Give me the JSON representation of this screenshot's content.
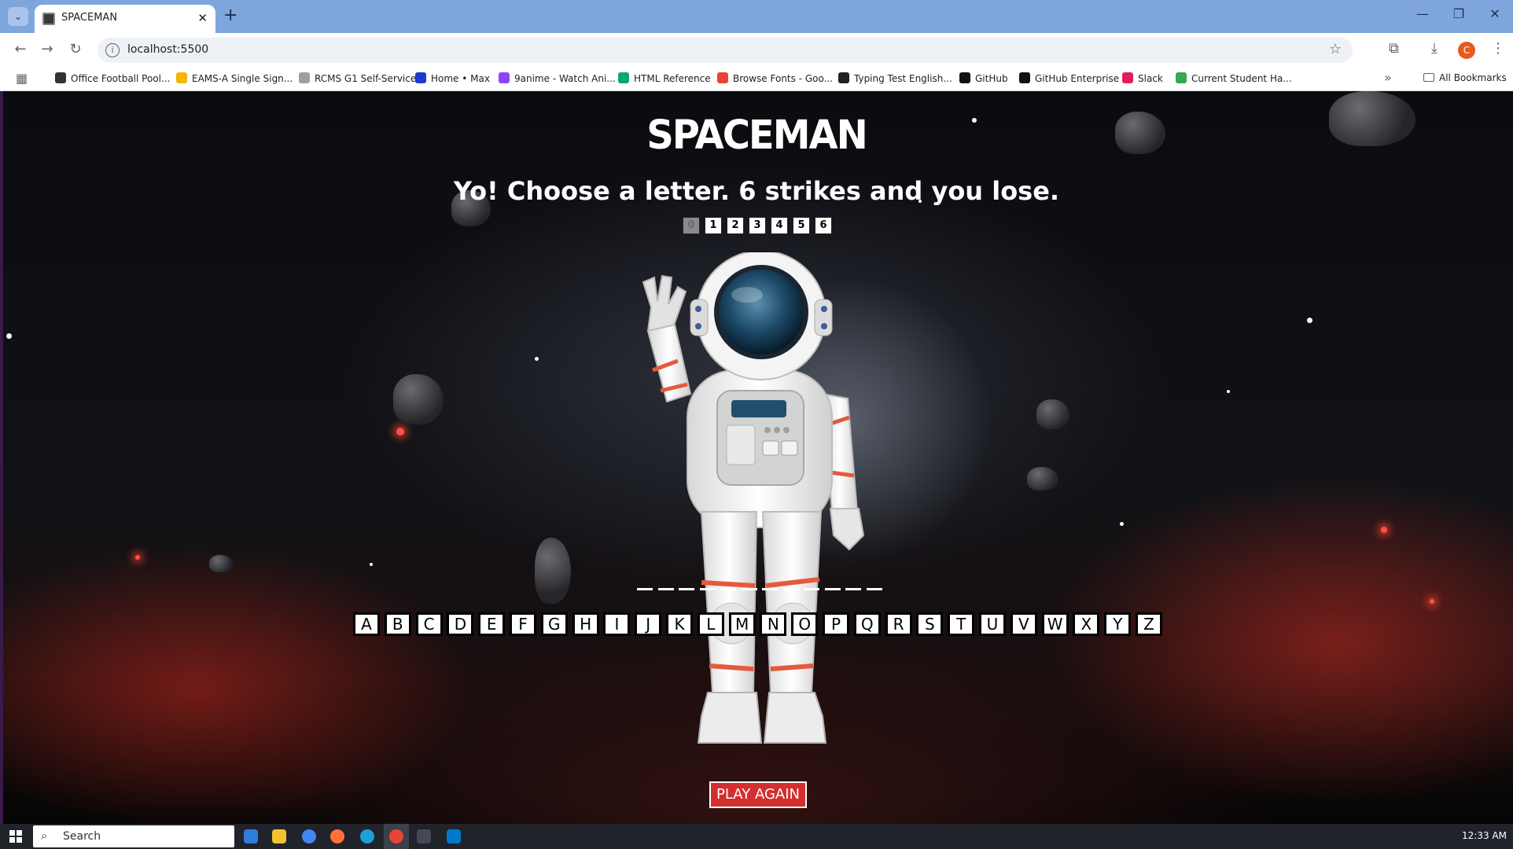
{
  "browser": {
    "tab_title": "SPACEMAN",
    "url": "localhost:5500",
    "profile_initial": "C",
    "bookmarks": [
      {
        "label": "Office Football Pool...",
        "color": "#333333"
      },
      {
        "label": "EAMS-A Single Sign...",
        "color": "#f4b400"
      },
      {
        "label": "RCMS G1 Self-Service",
        "color": "#9aa0a6"
      },
      {
        "label": "Home • Max",
        "color": "#1a3bd0"
      },
      {
        "label": "9anime - Watch Ani...",
        "color": "#8e44ff"
      },
      {
        "label": "HTML Reference",
        "color": "#04aa6d"
      },
      {
        "label": "Browse Fonts - Goo...",
        "color": "#ea4335"
      },
      {
        "label": "Typing Test English...",
        "color": "#222222"
      },
      {
        "label": "GitHub",
        "color": "#111111"
      },
      {
        "label": "GitHub Enterprise",
        "color": "#111111"
      },
      {
        "label": "Slack",
        "color": "#e01e5a"
      },
      {
        "label": "Current Student Ha...",
        "color": "#34a853"
      }
    ],
    "all_bookmarks": "All Bookmarks"
  },
  "game": {
    "title": "SPACEMAN",
    "message": "Yo! Choose a letter. 6 strikes and you lose.",
    "strikes": [
      "0",
      "1",
      "2",
      "3",
      "4",
      "5",
      "6"
    ],
    "current_strike": 0,
    "word_blanks": [
      "_",
      "_",
      "_",
      "_",
      "_",
      "_",
      "_",
      "_",
      "_",
      "_",
      "_",
      "_"
    ],
    "letters": [
      "A",
      "B",
      "C",
      "D",
      "E",
      "F",
      "G",
      "H",
      "I",
      "J",
      "K",
      "L",
      "M",
      "N",
      "O",
      "P",
      "Q",
      "R",
      "S",
      "T",
      "U",
      "V",
      "W",
      "X",
      "Y",
      "Z"
    ],
    "play_again": "PLAY AGAIN",
    "accent_color": "#d32f2f"
  },
  "taskbar": {
    "search_placeholder": "Search",
    "clock": "12:33 AM"
  }
}
